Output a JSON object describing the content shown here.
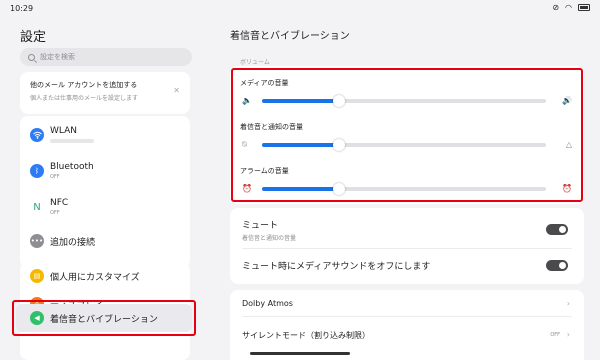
{
  "status": {
    "time": "10:29"
  },
  "left": {
    "title": "設定",
    "search_placeholder": "設定を検索",
    "add_account": {
      "title": "他のメール アカウントを追加する",
      "subtitle": "個人または仕事用のメールを設定します"
    },
    "connections": [
      {
        "label": "WLAN",
        "sub": "",
        "icon": "wifi-icon",
        "color": "#2d7cf6"
      },
      {
        "label": "Bluetooth",
        "sub": "OFF",
        "icon": "bluetooth-icon",
        "color": "#2d7cf6"
      },
      {
        "label": "NFC",
        "sub": "OFF",
        "icon": "nfc-icon",
        "color": "#ffffff"
      },
      {
        "label": "追加の接続",
        "sub": "",
        "icon": "more-icon",
        "color": "#8e8e93"
      }
    ],
    "personal": [
      {
        "label": "個人用にカスタマイズ",
        "icon": "palette-icon",
        "color": "#f5b800"
      },
      {
        "label": "ディスプレイ",
        "icon": "display-icon",
        "color": "#f27a1a"
      },
      {
        "label": "着信音とバイブレーション",
        "icon": "sound-icon",
        "color": "#2fc06a"
      }
    ]
  },
  "right": {
    "title": "着信音とバイブレーション",
    "section": "ボリューム",
    "volumes": [
      {
        "label": "メディアの音量",
        "level": 0.27,
        "left_icon": "speaker-mute-icon",
        "right_icon": "speaker-icon"
      },
      {
        "label": "着信音と通知の音量",
        "level": 0.27,
        "left_icon": "bell-off-icon",
        "right_icon": "bell-icon"
      },
      {
        "label": "アラームの音量",
        "level": 0.27,
        "left_icon": "alarm-off-icon",
        "right_icon": "alarm-icon"
      }
    ],
    "mute": {
      "title": "ミュート",
      "subtitle": "着信音と通知の音量"
    },
    "mute_media": {
      "title": "ミュート時にメディアサウンドをオフにします"
    },
    "dolby": "Dolby Atmos",
    "silent": {
      "label": "サイレントモード（割り込み制限）",
      "status": "OFF"
    }
  },
  "accent": "#1a73e8",
  "highlight_color": "#e60012"
}
